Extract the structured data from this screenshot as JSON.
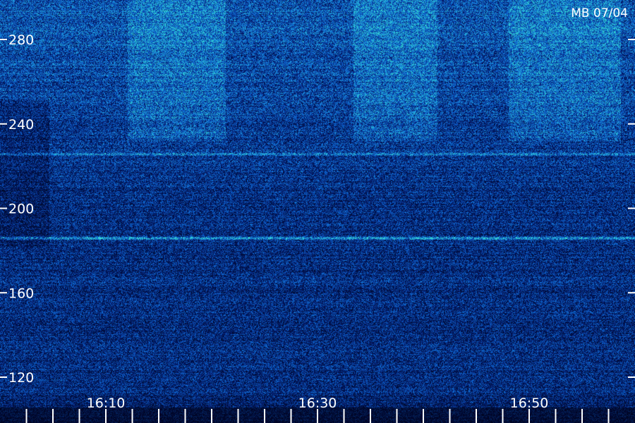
{
  "chart_data": {
    "type": "heatmap",
    "title": "MB 07/04",
    "xlabel": "",
    "ylabel": "",
    "x_time_range_minutes": [
      163,
      181
    ],
    "ylim": [
      113,
      293
    ],
    "x_ticks": [
      {
        "label": "16:10",
        "value_min": 170
      },
      {
        "label": "16:30",
        "value_min": 190
      },
      {
        "label": "16:50",
        "value_min": 210
      }
    ],
    "x_minor_ticks_min": [
      162.5,
      165,
      167.5,
      172.5,
      175,
      177.5,
      180,
      182.5,
      185,
      187.5,
      192.5,
      195,
      197.5,
      200,
      202.5,
      205,
      207.5,
      212.5,
      215,
      217.5
    ],
    "y_ticks": [
      120,
      160,
      200,
      240,
      280
    ],
    "colormap": [
      "#000028",
      "#0a1a7a",
      "#1e4fc8",
      "#2aa0e0",
      "#40e0d0"
    ],
    "bright_features": [
      {
        "freq": 186,
        "intensity": 0.55
      },
      {
        "freq": 226,
        "intensity": 0.35
      }
    ]
  },
  "labels": {
    "title": "MB 07/04"
  }
}
